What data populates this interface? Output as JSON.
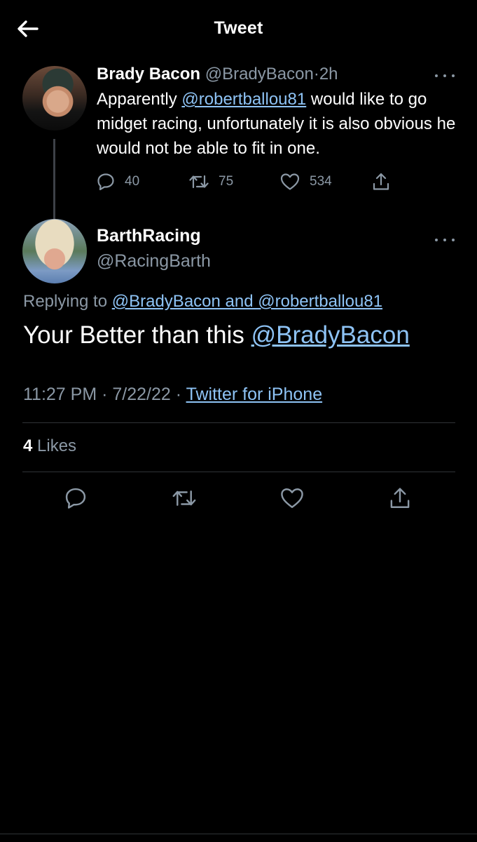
{
  "header": {
    "title": "Tweet",
    "back_icon": "arrow-left-icon"
  },
  "parent_tweet": {
    "display_name": "Brady Bacon",
    "handle": "@BradyBacon",
    "separator": "·",
    "time": "2h",
    "text_before": "Apparently ",
    "mention": "@robertballou81",
    "text_after": " would like to go midget racing, unfortunately it is also obvious he would not be able to fit in one.",
    "replies": "40",
    "retweets": "75",
    "likes": "534"
  },
  "main_tweet": {
    "display_name": "BarthRacing",
    "handle": "@RacingBarth",
    "replying_prefix": "Replying to ",
    "replying_to": "@BradyBacon and @robertballou81",
    "text_before": "Your Better than this ",
    "mention": "@BradyBacon",
    "time": "11:27 PM",
    "sep1": " · ",
    "date": "7/22/22",
    "sep2": " · ",
    "source": "Twitter for iPhone",
    "likes_count": "4",
    "likes_label": " Likes"
  },
  "colors": {
    "background": "#000000",
    "text": "#ffffff",
    "secondary": "#8b98a5",
    "link": "#8ec3f5",
    "divider": "#2f3336"
  },
  "icons": [
    "arrow-left-icon",
    "more-icon",
    "reply-icon",
    "retweet-icon",
    "like-icon",
    "share-icon"
  ]
}
